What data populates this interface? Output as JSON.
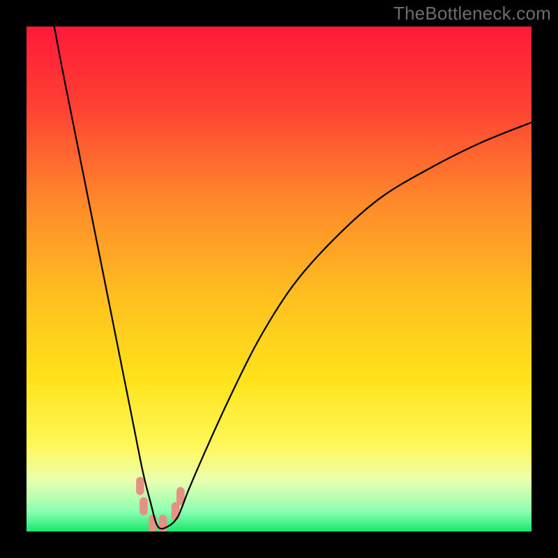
{
  "watermark": "TheBottleneck.com",
  "chart_data": {
    "type": "line",
    "title": "",
    "xlabel": "",
    "ylabel": "",
    "xlim": [
      0,
      100
    ],
    "ylim": [
      0,
      100
    ],
    "grid": false,
    "legend": false,
    "background": {
      "type": "vertical-gradient",
      "stops": [
        {
          "pct": 0,
          "color": "#ff1a3a"
        },
        {
          "pct": 15,
          "color": "#ff3e34"
        },
        {
          "pct": 35,
          "color": "#ff8a2a"
        },
        {
          "pct": 55,
          "color": "#ffc31f"
        },
        {
          "pct": 70,
          "color": "#ffe31a"
        },
        {
          "pct": 83,
          "color": "#fff85a"
        },
        {
          "pct": 90,
          "color": "#e9ffb0"
        },
        {
          "pct": 96,
          "color": "#8cffb0"
        },
        {
          "pct": 100,
          "color": "#17e86f"
        }
      ]
    },
    "series": [
      {
        "name": "bottleneck-curve",
        "color": "#000000",
        "stroke_width": 2.2,
        "x": [
          5.5,
          7,
          9,
          11,
          13,
          15,
          17,
          19,
          21,
          23,
          24.5,
          26,
          28,
          30,
          32,
          35,
          40,
          46,
          53,
          61,
          70,
          80,
          90,
          100
        ],
        "y": [
          100,
          92,
          82,
          72,
          62,
          52,
          42,
          32,
          22,
          12,
          6,
          1,
          1,
          3,
          8,
          15,
          26,
          38,
          49,
          58,
          66,
          72,
          77,
          81
        ]
      }
    ],
    "markers": [
      {
        "x": 22.5,
        "y": 9,
        "color": "#e59183"
      },
      {
        "x": 23.2,
        "y": 5,
        "color": "#e59183"
      },
      {
        "x": 25.0,
        "y": 1.5,
        "color": "#e59183"
      },
      {
        "x": 27.0,
        "y": 1.5,
        "color": "#e59183"
      },
      {
        "x": 29.5,
        "y": 4,
        "color": "#e59183"
      },
      {
        "x": 30.5,
        "y": 7,
        "color": "#e59183"
      }
    ]
  }
}
